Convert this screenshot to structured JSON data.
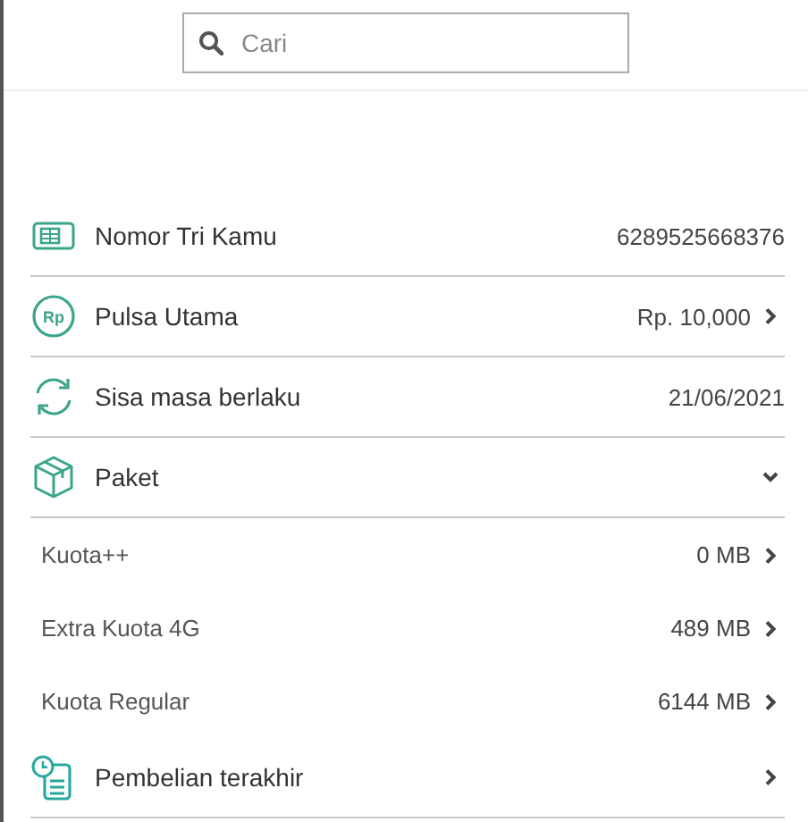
{
  "search": {
    "placeholder": "Cari"
  },
  "rows": [
    {
      "kind": "sim",
      "label": "Nomor Tri Kamu",
      "value": "6289525668376",
      "link": false
    },
    {
      "kind": "money",
      "icon_text": "Rp",
      "label": "Pulsa Utama",
      "value": "Rp. 10,000",
      "link": true
    },
    {
      "kind": "refresh",
      "label": "Sisa masa berlaku",
      "value": "21/06/2021",
      "link": false
    },
    {
      "kind": "box",
      "label": "Paket",
      "link": true,
      "expanded": true,
      "children": [
        {
          "label": "Kuota++",
          "value": "0 MB"
        },
        {
          "label": "Extra Kuota 4G",
          "value": "489 MB"
        },
        {
          "label": "Kuota Regular",
          "value": "6144 MB"
        }
      ]
    },
    {
      "kind": "history",
      "label": "Pembelian terakhir",
      "link": true
    }
  ]
}
